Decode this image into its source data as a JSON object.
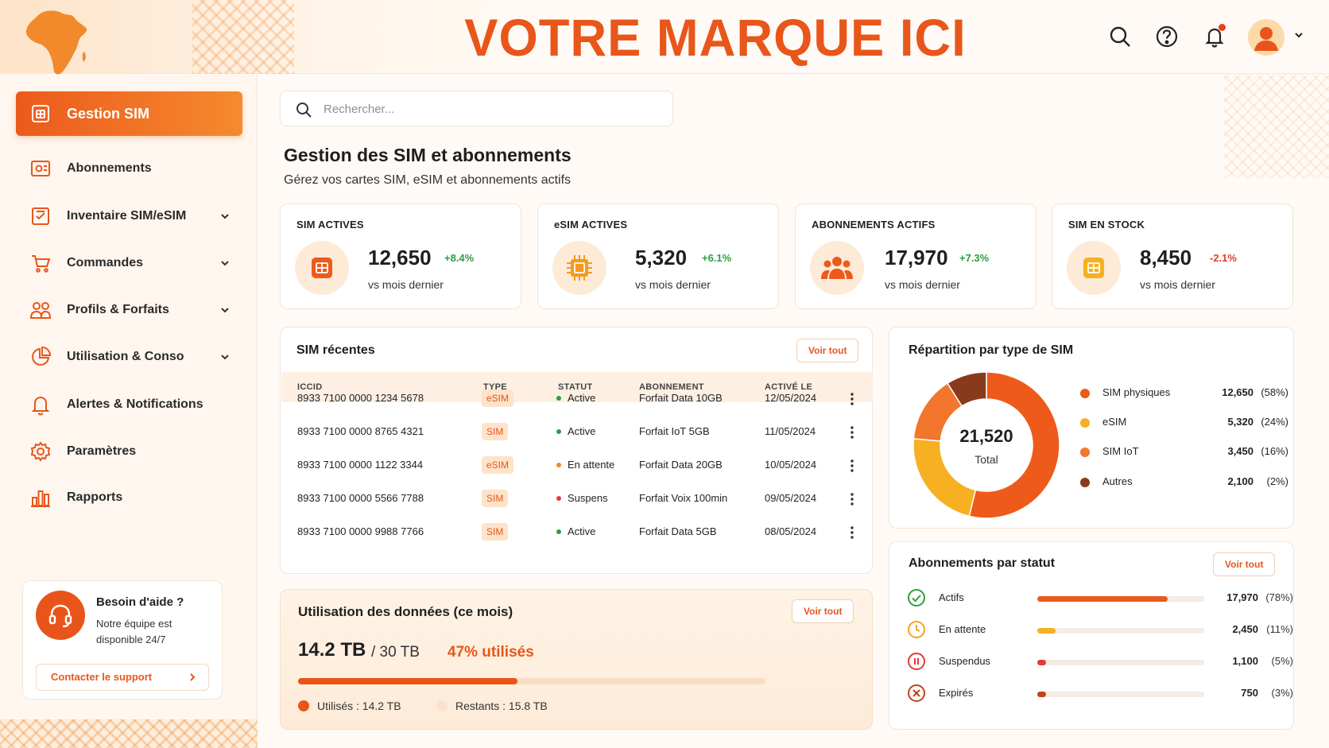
{
  "header": {
    "brand": "VOTRE MARQUE ICI",
    "icons": [
      "search-icon",
      "help-icon",
      "bell-icon",
      "user-avatar",
      "chevron-down-icon"
    ]
  },
  "sidebar": {
    "items": [
      {
        "label": "Gestion SIM",
        "icon": "sim-card-icon",
        "active": true,
        "has_submenu": false
      },
      {
        "label": "Abonnements",
        "icon": "subscription-icon",
        "active": false,
        "has_submenu": false
      },
      {
        "label": "Inventaire SIM/eSIM",
        "icon": "inventory-icon",
        "active": false,
        "has_submenu": true
      },
      {
        "label": "Commandes",
        "icon": "cart-icon",
        "active": false,
        "has_submenu": true
      },
      {
        "label": "Profils & Forfaits",
        "icon": "users-icon",
        "active": false,
        "has_submenu": true
      },
      {
        "label": "Utilisation & Conso",
        "icon": "pie-chart-icon",
        "active": false,
        "has_submenu": true
      },
      {
        "label": "Alertes & Notifications",
        "icon": "bell-icon",
        "active": false,
        "has_submenu": false
      },
      {
        "label": "Paramètres",
        "icon": "gear-icon",
        "active": false,
        "has_submenu": false
      },
      {
        "label": "Rapports",
        "icon": "bar-chart-icon",
        "active": false,
        "has_submenu": false
      }
    ],
    "help": {
      "title": "Besoin d'aide ?",
      "description": "Notre équipe est disponible 24/7",
      "button": "Contacter le support"
    }
  },
  "search": {
    "placeholder": "Rechercher..."
  },
  "page": {
    "title": "Gestion des SIM et abonnements",
    "subtitle": "Gérez vos cartes SIM, eSIM et abonnements actifs"
  },
  "kpis": [
    {
      "label": "SIM ACTIVES",
      "value": "12,650",
      "delta": "+8.4%",
      "trend": "up",
      "sub": "vs mois dernier",
      "icon": "sim-card-icon"
    },
    {
      "label": "eSIM ACTIVES",
      "value": "5,320",
      "delta": "+6.1%",
      "trend": "up",
      "sub": "vs mois dernier",
      "icon": "chip-icon"
    },
    {
      "label": "ABONNEMENTS ACTIFS",
      "value": "17,970",
      "delta": "+7.3%",
      "trend": "up",
      "sub": "vs mois dernier",
      "icon": "users-icon"
    },
    {
      "label": "SIM EN STOCK",
      "value": "8,450",
      "delta": "-2.1%",
      "trend": "down",
      "sub": "vs mois dernier",
      "icon": "sim-card-icon"
    }
  ],
  "recent": {
    "title": "SIM récentes",
    "view_all": "Voir tout",
    "columns": [
      "ICCID",
      "TYPE",
      "STATUT",
      "ABONNEMENT",
      "ACTIVÉ LE"
    ],
    "rows": [
      {
        "iccid": "8933 7100 0000 1234 5678",
        "type": "eSIM",
        "status": "Active",
        "status_color": "#2e9e3e",
        "plan": "Forfait Data 10GB",
        "date": "12/05/2024"
      },
      {
        "iccid": "8933 7100 0000 8765 4321",
        "type": "SIM",
        "status": "Active",
        "status_color": "#2e9e3e",
        "plan": "Forfait IoT 5GB",
        "date": "11/05/2024"
      },
      {
        "iccid": "8933 7100 0000 1122 3344",
        "type": "eSIM",
        "status": "En attente",
        "status_color": "#f08a24",
        "plan": "Forfait Data 20GB",
        "date": "10/05/2024"
      },
      {
        "iccid": "8933 7100 0000 5566 7788",
        "type": "SIM",
        "status": "Suspens",
        "status_color": "#e53935",
        "plan": "Forfait Voix 100min",
        "date": "09/05/2024"
      },
      {
        "iccid": "8933 7100 0000 9988 7766",
        "type": "SIM",
        "status": "Active",
        "status_color": "#2e9e3e",
        "plan": "Forfait Data 5GB",
        "date": "08/05/2024"
      }
    ]
  },
  "usage": {
    "title": "Utilisation des données (ce mois)",
    "view_all": "Voir tout",
    "used": "14.2 TB",
    "total": "/ 30 TB",
    "percent_label": "47% utilisés",
    "percent": 47,
    "legend_used": "Utilisés : 14.2 TB",
    "legend_remaining": "Restants : 15.8 TB"
  },
  "distribution": {
    "title": "Répartition par type de SIM",
    "total": "21,520",
    "total_label": "Total",
    "items": [
      {
        "label": "SIM physiques",
        "value": "12,650",
        "pct": "(58%)",
        "color": "#ee5a1a"
      },
      {
        "label": "eSIM",
        "value": "5,320",
        "pct": "(24%)",
        "color": "#f7b021"
      },
      {
        "label": "SIM IoT",
        "value": "3,450",
        "pct": "(16%)",
        "color": "#f2762b"
      },
      {
        "label": "Autres",
        "value": "2,100",
        "pct": "(2%)",
        "color": "#8a3a1c"
      }
    ]
  },
  "chart_data": {
    "type": "pie",
    "title": "Répartition par type de SIM",
    "categories": [
      "SIM physiques",
      "eSIM",
      "SIM IoT",
      "Autres"
    ],
    "values": [
      12650,
      5320,
      3450,
      2100
    ],
    "percent": [
      58,
      24,
      16,
      2
    ]
  },
  "status": {
    "title": "Abonnements par statut",
    "view_all": "Voir tout",
    "items": [
      {
        "label": "Actifs",
        "value": "17,970",
        "pct": "(78%)",
        "fraction": 0.78,
        "color": "#ea5a1c",
        "icon": "check-circle-icon"
      },
      {
        "label": "En attente",
        "value": "2,450",
        "pct": "(11%)",
        "fraction": 0.11,
        "color": "#f7b021",
        "icon": "clock-icon"
      },
      {
        "label": "Suspendus",
        "value": "1,100",
        "pct": "(5%)",
        "fraction": 0.05,
        "color": "#e53935",
        "icon": "pause-circle-icon"
      },
      {
        "label": "Expirés",
        "value": "750",
        "pct": "(3%)",
        "fraction": 0.03,
        "color": "#c0441b",
        "icon": "x-circle-icon"
      }
    ]
  }
}
